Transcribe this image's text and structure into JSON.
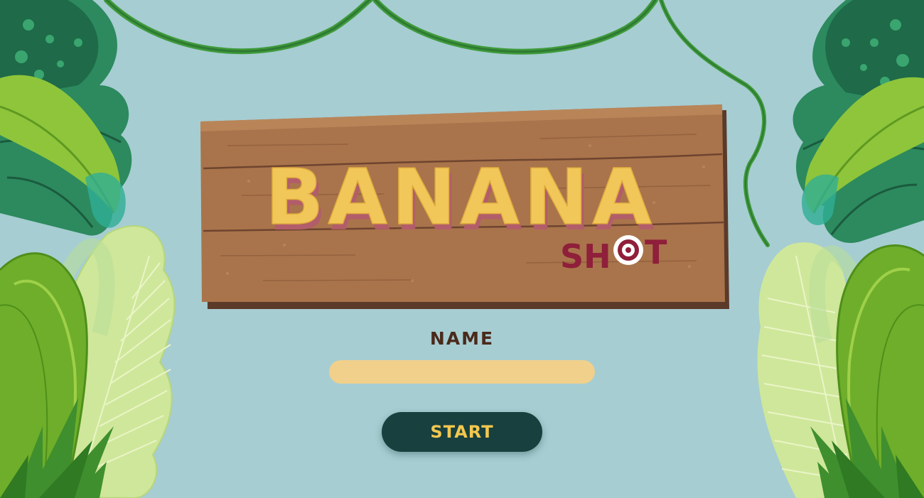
{
  "game": {
    "title_main": "BANANA",
    "title_sub_prefix": "SH",
    "title_sub_suffix": "T",
    "name_label": "NAME",
    "name_value": "",
    "start_label": "START"
  },
  "icons": {
    "title_target": "target-icon"
  },
  "colors": {
    "background": "#a6cdd2",
    "sign_wood": "#a9744b",
    "sign_shadow": "#5b3a2a",
    "title_yellow": "#f2c75a",
    "title_shadow": "#b25d6a",
    "shot_red": "#8f1f3a",
    "input_fill": "#f0d08a",
    "button_fill": "#17403f",
    "button_text": "#f3c74f",
    "label_text": "#4a2a1c"
  }
}
